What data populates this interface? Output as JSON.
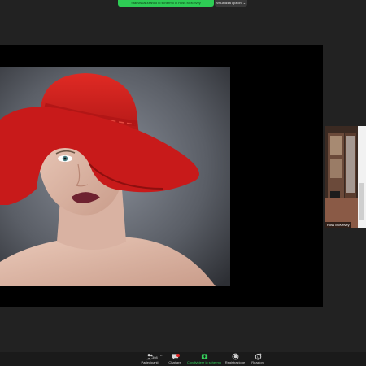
{
  "top_bar": {
    "share_banner": "Stai visualizzando lo schermo di Ross McKelvey",
    "view_options": "Visualizza opzioni ⌄"
  },
  "participant": {
    "name": "Ross McKelvey"
  },
  "toolbar": {
    "participants_count": "308",
    "participants_label": "Partecipanti",
    "chat_label": "Chattare",
    "share_label": "Condividere lo schermo",
    "record_label": "Registrazione",
    "reactions_label": "Reazioni"
  },
  "colors": {
    "share_green": "#2ecc55",
    "hat_red": "#d21f1f",
    "lip_color": "#6e2230"
  },
  "icons": [
    "participants-icon",
    "chat-icon",
    "share-screen-icon",
    "record-icon",
    "reactions-icon"
  ]
}
